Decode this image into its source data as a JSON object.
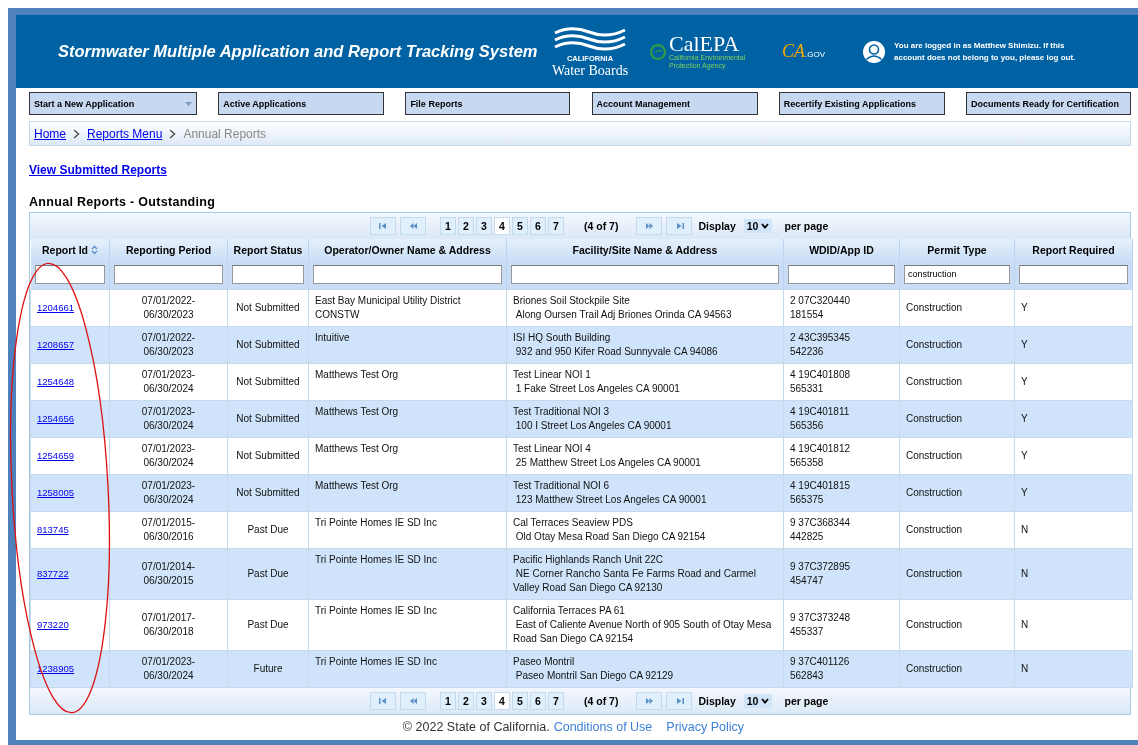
{
  "header": {
    "title": "Stormwater Multiple Application and Report Tracking System",
    "water_boards": {
      "state": "CALIFORNIA",
      "name": "Water Boards"
    },
    "calepa": {
      "name": "CalEPA",
      "subtitle": "California Environmental Protection Agency"
    },
    "cagov": {
      "ca": "CA",
      "gov": ".GOV"
    },
    "login_message": "You are logged in as Matthew Shimizu. If this account does not belong to you, please log out."
  },
  "nav": [
    {
      "label": "Start a New Application",
      "dropdown": true
    },
    {
      "label": "Active Applications",
      "dropdown": false
    },
    {
      "label": "File Reports",
      "dropdown": false
    },
    {
      "label": "Account Management",
      "dropdown": false
    },
    {
      "label": "Recertify Existing Applications",
      "dropdown": false
    },
    {
      "label": "Documents Ready for Certification",
      "dropdown": false
    }
  ],
  "breadcrumb": [
    {
      "label": "Home",
      "current": false
    },
    {
      "label": "Reports Menu",
      "current": false
    },
    {
      "label": "Annual Reports",
      "current": true
    }
  ],
  "view_link": "View Submitted Reports",
  "section_title": "Annual Reports - Outstanding",
  "top_pager": {
    "pages": [
      {
        "label": "1",
        "selected": false
      },
      {
        "label": "2",
        "selected": false
      },
      {
        "label": "3",
        "selected": false
      },
      {
        "label": "4",
        "selected": true
      },
      {
        "label": "5",
        "selected": false
      },
      {
        "label": "6",
        "selected": false
      },
      {
        "label": "7",
        "selected": false
      }
    ],
    "summary": "(4 of 7)",
    "display": "Display",
    "per_page_value": "10",
    "per_page": "per page"
  },
  "columns": [
    {
      "label": "Report Id",
      "sortable": true
    },
    {
      "label": "Reporting Period",
      "sortable": false
    },
    {
      "label": "Report Status",
      "sortable": false
    },
    {
      "label": "Operator/Owner Name & Address",
      "sortable": false
    },
    {
      "label": "Facility/Site Name & Address",
      "sortable": false
    },
    {
      "label": "WDID/App ID",
      "sortable": false
    },
    {
      "label": "Permit Type",
      "sortable": false,
      "filter": "construction"
    },
    {
      "label": "Report Required",
      "sortable": false
    }
  ],
  "rows": [
    {
      "id": "1204661",
      "period": "07/01/2022-06/30/2023",
      "status": "Not Submitted",
      "operator": [
        "East Bay Municipal Utility District",
        "CONSTW"
      ],
      "facility": "Briones Soil Stockpile Site",
      "facility_address": " Along Oursen Trail Adj Briones Orinda CA 94563",
      "wdid": "2 07C320440",
      "app_id": "181554",
      "permit": "Construction",
      "required": "Y"
    },
    {
      "id": "1208657",
      "period": "07/01/2022-06/30/2023",
      "status": "Not Submitted",
      "operator": [
        "Intuitive"
      ],
      "facility": "ISI HQ South Building",
      "facility_address": " 932 and 950 Kifer Road Sunnyvale CA 94086",
      "wdid": "2 43C395345",
      "app_id": "542236",
      "permit": "Construction",
      "required": "Y"
    },
    {
      "id": "1254648",
      "period": "07/01/2023-06/30/2024",
      "status": "Not Submitted",
      "operator": [
        "Matthews Test Org"
      ],
      "facility": "Test Linear NOI 1",
      "facility_address": " 1 Fake Street Los Angeles CA 90001",
      "wdid": "4 19C401808",
      "app_id": "565331",
      "permit": "Construction",
      "required": "Y"
    },
    {
      "id": "1254656",
      "period": "07/01/2023-06/30/2024",
      "status": "Not Submitted",
      "operator": [
        "Matthews Test Org"
      ],
      "facility": "Test Traditional NOI 3",
      "facility_address": " 100 I Street Los Angeles CA 90001",
      "wdid": "4 19C401811",
      "app_id": "565356",
      "permit": "Construction",
      "required": "Y"
    },
    {
      "id": "1254659",
      "period": "07/01/2023-06/30/2024",
      "status": "Not Submitted",
      "operator": [
        "Matthews Test Org"
      ],
      "facility": "Test Linear NOI 4",
      "facility_address": " 25 Matthew Street Los Angeles CA 90001",
      "wdid": "4 19C401812",
      "app_id": "565358",
      "permit": "Construction",
      "required": "Y"
    },
    {
      "id": "1258005",
      "period": "07/01/2023-06/30/2024",
      "status": "Not Submitted",
      "operator": [
        "Matthews Test Org"
      ],
      "facility": "Test Traditional NOI 6",
      "facility_address": " 123 Matthew Street Los Angeles CA 90001",
      "wdid": "4 19C401815",
      "app_id": "565375",
      "permit": "Construction",
      "required": "Y"
    },
    {
      "id": "813745",
      "period": "07/01/2015-06/30/2016",
      "status": "Past Due",
      "operator": [
        "Tri Pointe Homes IE SD Inc"
      ],
      "facility": "Cal Terraces Seaview PDS",
      "facility_address": " Old Otay Mesa Road San Diego CA 92154",
      "wdid": "9 37C368344",
      "app_id": "442825",
      "permit": "Construction",
      "required": "N"
    },
    {
      "id": "837722",
      "period": "07/01/2014-06/30/2015",
      "status": "Past Due",
      "operator": [
        "Tri Pointe Homes IE SD Inc"
      ],
      "facility": "Pacific Highlands Ranch Unit 22C",
      "facility_address": " NE Corner Rancho Santa Fe Farms Road and Carmel Valley Road San Diego CA 92130",
      "wdid": "9 37C372895",
      "app_id": "454747",
      "permit": "Construction",
      "required": "N"
    },
    {
      "id": "973220",
      "period": "07/01/2017-06/30/2018",
      "status": "Past Due",
      "operator": [
        "Tri Pointe Homes IE SD Inc"
      ],
      "facility": "California Terraces PA 61",
      "facility_address": " East of Caliente Avenue North of 905 South of Otay Mesa Road San Diego CA 92154",
      "wdid": "9 37C373248",
      "app_id": "455337",
      "permit": "Construction",
      "required": "N"
    },
    {
      "id": "1238905",
      "period": "07/01/2023-06/30/2024",
      "status": "Future",
      "operator": [
        "Tri Pointe Homes IE SD Inc"
      ],
      "facility": "Paseo Montril",
      "facility_address": " Paseo Montril San Diego CA 92129",
      "wdid": "9 37C401126",
      "app_id": "562843",
      "permit": "Construction",
      "required": "N"
    }
  ],
  "bottom_pager": {
    "pages": [
      {
        "label": "1",
        "selected": false
      },
      {
        "label": "2",
        "selected": false
      },
      {
        "label": "3",
        "selected": false
      },
      {
        "label": "4",
        "selected": true
      },
      {
        "label": "5",
        "selected": false
      },
      {
        "label": "6",
        "selected": false
      },
      {
        "label": "7",
        "selected": false
      }
    ],
    "summary": "(4 of 7)",
    "display": "Display",
    "per_page_value": "10",
    "per_page": "per page"
  },
  "footer": {
    "copyright": "© 2022 State of California.",
    "links": [
      "Conditions of Use",
      "Privacy Policy"
    ]
  }
}
